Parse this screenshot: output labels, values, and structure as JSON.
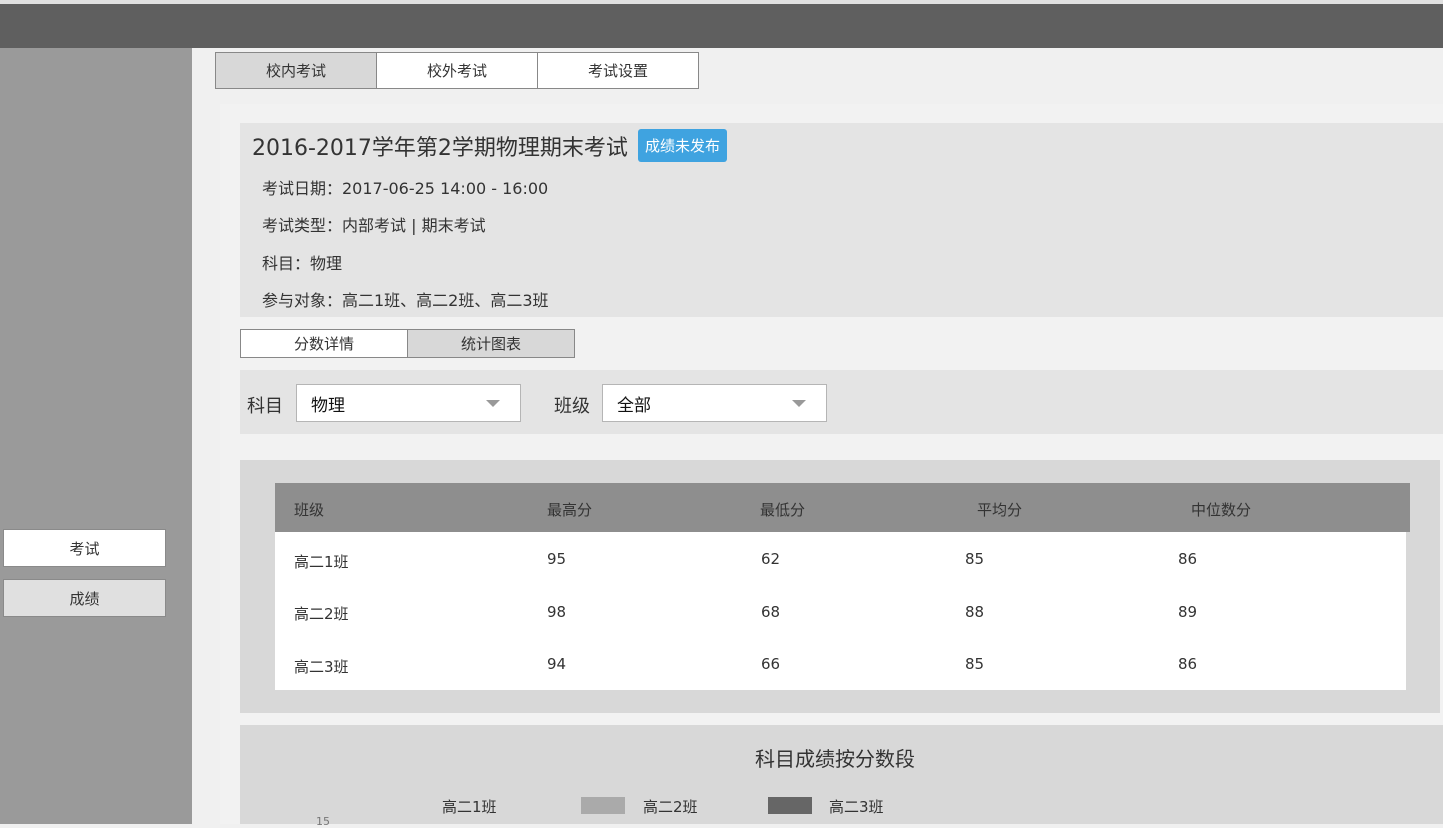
{
  "sidebar": {
    "items": [
      {
        "label": "考试"
      },
      {
        "label": "成绩"
      }
    ]
  },
  "top_tabs": [
    {
      "label": "校内考试"
    },
    {
      "label": "校外考试"
    },
    {
      "label": "考试设置"
    }
  ],
  "exam": {
    "title": "2016-2017学年第2学期物理期末考试",
    "status": "成绩未发布",
    "date_line": "考试日期：2017-06-25   14:00 -  16:00",
    "type_line": "考试类型：内部考试 | 期末考试",
    "subject_line": "科目：物理",
    "participants_line": "参与对象：高二1班、高二2班、高二3班"
  },
  "sub_tabs": [
    {
      "label": "分数详情"
    },
    {
      "label": "统计图表"
    }
  ],
  "filters": {
    "subject_label": "科目",
    "subject_value": "物理",
    "class_label": "班级",
    "class_value": "全部"
  },
  "table": {
    "headers": [
      "班级",
      "最高分",
      "最低分",
      "平均分",
      "中位数分"
    ],
    "rows": [
      [
        "高二1班",
        "95",
        "62",
        "85",
        "86"
      ],
      [
        "高二2班",
        "98",
        "68",
        "88",
        "89"
      ],
      [
        "高二3班",
        "94",
        "66",
        "85",
        "86"
      ]
    ]
  },
  "chart": {
    "title": "科目成绩按分数段",
    "legend": [
      {
        "name": "高二1班",
        "color": "#d8d8d8"
      },
      {
        "name": "高二2班",
        "color": "#aaaaaa"
      },
      {
        "name": "高二3班",
        "color": "#666666"
      }
    ],
    "visible_tick": "15"
  },
  "colors": {
    "topbar": "#5f5f5f",
    "sidebar": "#9a9a9a",
    "badge": "#3fa3e0",
    "table_header": "#8e8e8e"
  }
}
